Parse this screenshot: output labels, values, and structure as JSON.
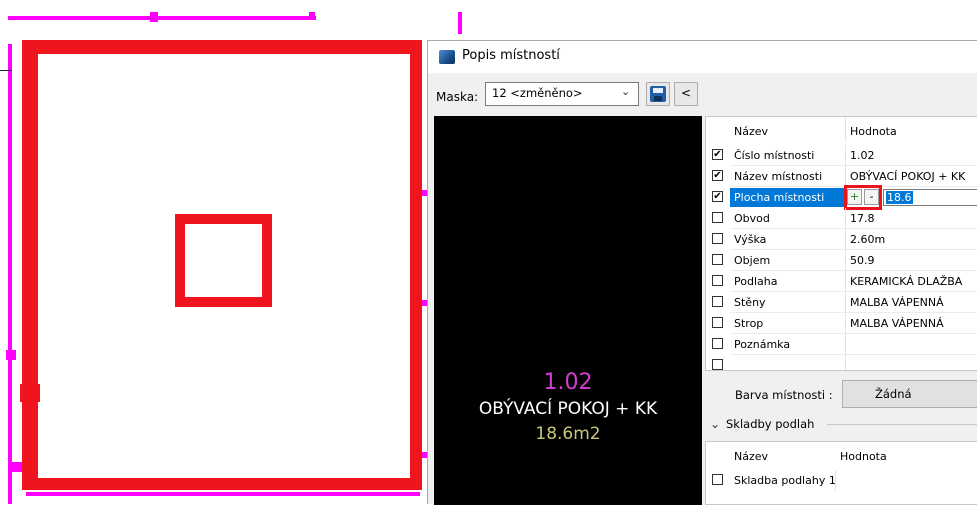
{
  "dialog": {
    "title": "Popis místností",
    "mask_label": "Maska:",
    "mask_value": "12 <změněno>",
    "back_label": "<"
  },
  "preview": {
    "number": "1.02",
    "name": "OBÝVACÍ POKOJ + KK",
    "area": "18.6m2"
  },
  "properties": {
    "header_name": "Název",
    "header_value": "Hodnota",
    "rows": [
      {
        "checked": true,
        "name": "Číslo místnosti",
        "value": "1.02"
      },
      {
        "checked": true,
        "name": "Název místnosti",
        "value": "OBÝVACÍ POKOJ + KK"
      },
      {
        "checked": true,
        "name": "Plocha místnosti",
        "value": "18.6",
        "selected": true
      },
      {
        "checked": false,
        "name": "Obvod",
        "value": "17.8"
      },
      {
        "checked": false,
        "name": "Výška",
        "value": "2.60m"
      },
      {
        "checked": false,
        "name": "Objem",
        "value": "50.9"
      },
      {
        "checked": false,
        "name": "Podlaha",
        "value": "KERAMICKÁ DLAŽBA"
      },
      {
        "checked": false,
        "name": "Stěny",
        "value": "MALBA VÁPENNÁ"
      },
      {
        "checked": false,
        "name": "Strop",
        "value": "MALBA VÁPENNÁ"
      },
      {
        "checked": false,
        "name": "Poznámka",
        "value": ""
      }
    ],
    "plus_label": "+",
    "minus_label": "-"
  },
  "room_color": {
    "label": "Barva místnosti :",
    "value": "Žádná"
  },
  "floors": {
    "section_label": "Skladby podlah",
    "header_name": "Název",
    "header_value": "Hodnota",
    "rows": [
      {
        "checked": false,
        "name": "Skladba podlahy 1"
      }
    ]
  },
  "colors": {
    "wall_red": "#f0141e",
    "wall_magenta": "#ff00ff",
    "selection_blue": "#0078d7",
    "preview_number": "#d23cd2",
    "preview_area": "#c8c878"
  }
}
